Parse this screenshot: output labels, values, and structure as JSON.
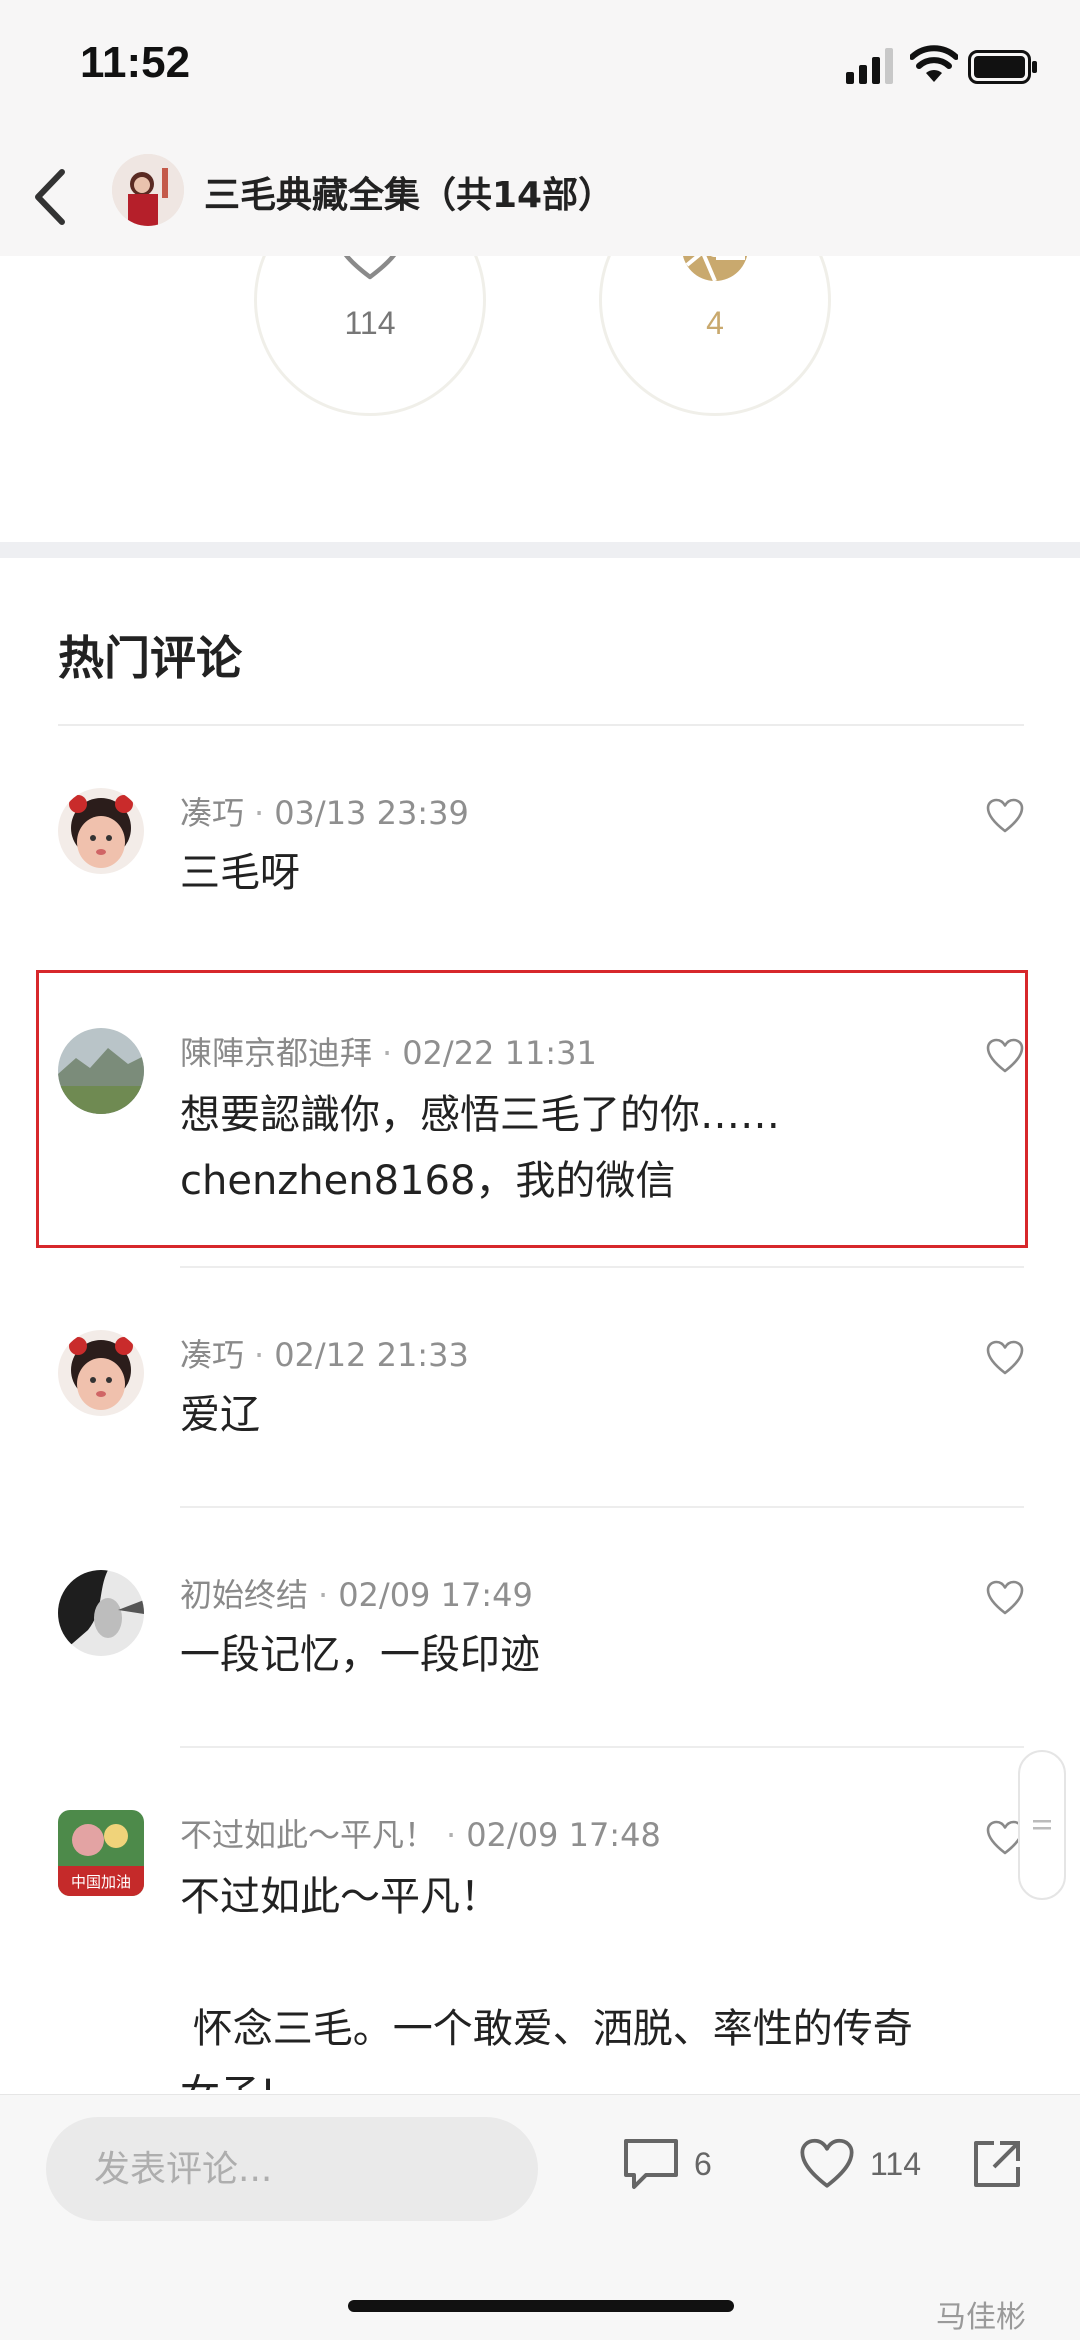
{
  "status_bar": {
    "time": "11:52"
  },
  "nav": {
    "title": "三毛典藏全集（共14部）"
  },
  "stats": {
    "likes": "114",
    "rewards": "4"
  },
  "section_title": "热门评论",
  "comments": [
    {
      "user": "凑巧",
      "time": "03/13 23:39",
      "body": "三毛呀"
    },
    {
      "user": "陳陣京都迪拜",
      "time": "02/22 11:31",
      "body": "想要認識你，感悟三毛了的你……\nchenzhen8168，我的微信"
    },
    {
      "user": "凑巧",
      "time": "02/12 21:33",
      "body": "爱辽"
    },
    {
      "user": "初始终结",
      "time": "02/09 17:49",
      "body": "一段记忆，一段印迹"
    },
    {
      "user": "不过如此～平凡！",
      "time": "02/09 17:48",
      "body": "不过如此～平凡！\n\n 怀念三毛。一个敢爱、洒脱、率性的传奇\n女子!",
      "avatar_text": "中国加油"
    }
  ],
  "bottom_bar": {
    "input_placeholder": "发表评论...",
    "comment_count": "6",
    "like_count": "114"
  },
  "watermark": "马佳彬",
  "colors": {
    "accent_gold": "#c9a96e",
    "highlight_red": "#d7272b"
  }
}
